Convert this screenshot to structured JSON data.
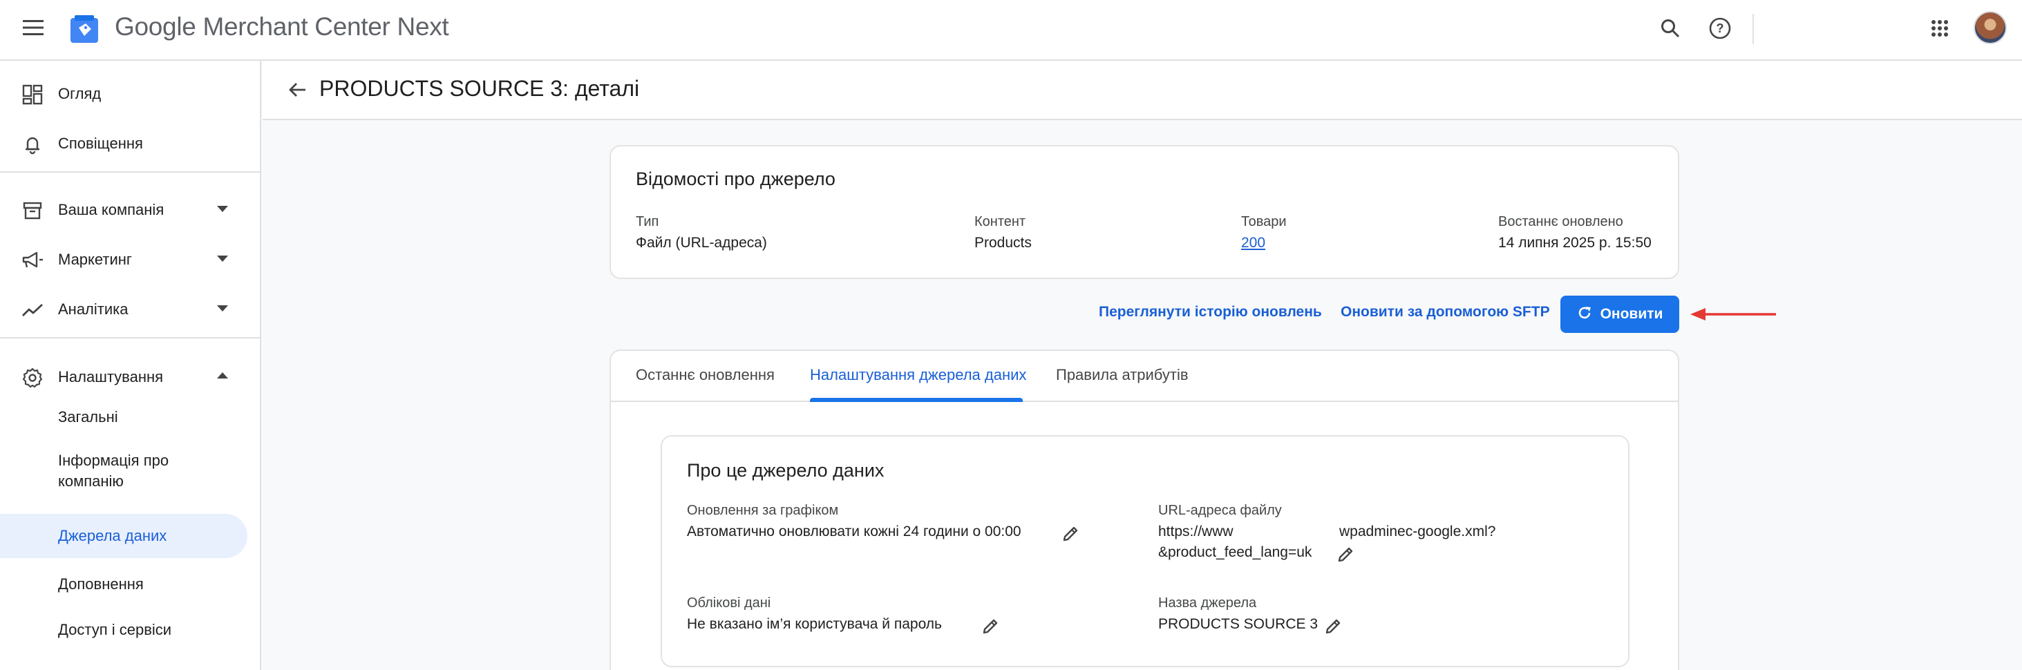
{
  "app": {
    "title": "Google Merchant Center Next",
    "brand_color": "#1a73e8"
  },
  "topbar": {
    "menu_icon": "menu-icon",
    "search_icon": "search-icon",
    "help_icon": "help-icon",
    "apps_icon": "apps-grid-icon",
    "avatar": "avatar"
  },
  "sidebar": {
    "items": [
      {
        "label": "Огляд",
        "icon": "dashboard-icon"
      },
      {
        "label": "Сповіщення",
        "icon": "bell-icon"
      },
      {
        "label": "Ваша компанія",
        "icon": "store-icon"
      },
      {
        "label": "Маркетинг",
        "icon": "megaphone-icon"
      },
      {
        "label": "Аналітика",
        "icon": "trending-icon"
      },
      {
        "label": "Налаштування",
        "icon": "gear-icon"
      }
    ],
    "subitems": [
      {
        "label": "Загальні"
      },
      {
        "label": "Інформація про компанію"
      },
      {
        "label": "Джерела даних",
        "active": true
      },
      {
        "label": "Доповнення"
      },
      {
        "label": "Доступ і сервіси"
      }
    ]
  },
  "page": {
    "title": "PRODUCTS SOURCE 3: деталі"
  },
  "source_info": {
    "title": "Відомості про джерело",
    "fields": [
      {
        "label": "Тип",
        "value": "Файл (URL-адреса)"
      },
      {
        "label": "Контент",
        "value": "Products"
      },
      {
        "label": "Товари",
        "value": "200"
      },
      {
        "label": "Востаннє оновлено",
        "value": "14 липня 2025 р. 15:50"
      }
    ]
  },
  "actions": {
    "history": "Переглянути історію оновлень",
    "sftp": "Оновити за допомогою SFTP",
    "update": "Оновити"
  },
  "tabs": [
    {
      "label": "Останнє оновлення"
    },
    {
      "label": "Налаштування джерела даних",
      "active": true
    },
    {
      "label": "Правила атрибутів"
    }
  ],
  "about": {
    "title": "Про це джерело даних",
    "schedule_label": "Оновлення за графіком",
    "schedule_value": "Автоматично оновлювати кожні 24 години о 00:00",
    "url_label": "URL-адреса файлу",
    "url_line1_a": "https://www",
    "url_line1_b": "wpadminec-google.xml?",
    "url_line2": "&product_feed_lang=uk",
    "credentials_label": "Облікові дані",
    "credentials_value": "Не вказано ім’я користувача й пароль",
    "source_name_label": "Назва джерела",
    "source_name_value": "PRODUCTS SOURCE 3"
  }
}
